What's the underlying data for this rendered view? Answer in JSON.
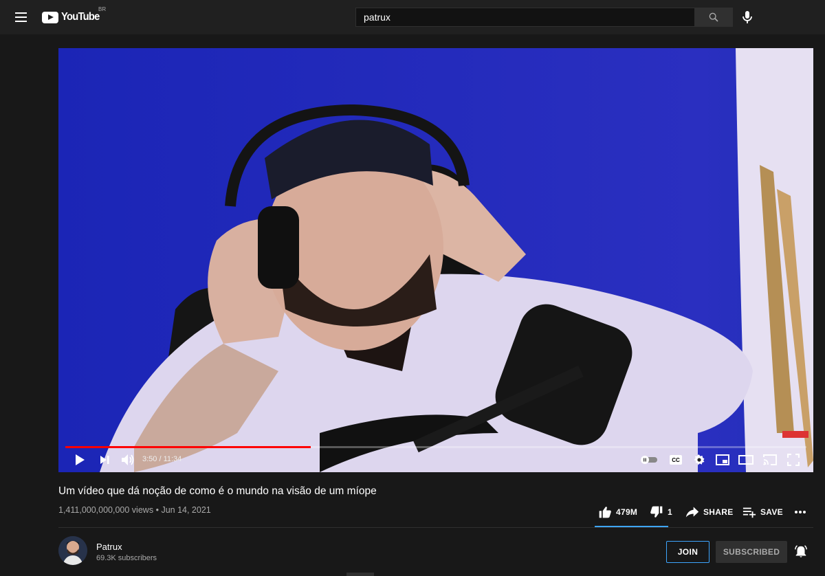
{
  "masthead": {
    "logo_text": "YouTube",
    "country_code": "BR",
    "search_value": "patrux",
    "icons": {
      "menu": "hamburger-icon",
      "search": "search-icon",
      "mic": "microphone-icon"
    }
  },
  "player": {
    "time_display": "3:50 / 11:34",
    "progress_fraction": 0.331,
    "controls": [
      "play-icon",
      "next-icon",
      "volume-icon",
      "autoplay-toggle",
      "captions-icon",
      "settings-icon",
      "miniplayer-icon",
      "theater-icon",
      "cast-icon",
      "fullscreen-icon"
    ],
    "captions_label": "CC"
  },
  "video": {
    "title": "Um vídeo que dá noção de como é o mundo na visão de um míope",
    "views": "1,411,000,000,000 views",
    "separator": "•",
    "date": "Jun 14, 2021"
  },
  "actions": {
    "like_count": "479M",
    "dislike_count": "1",
    "share_label": "SHARE",
    "save_label": "SAVE",
    "like_ratio": 1.0
  },
  "channel": {
    "name": "Patrux",
    "subscribers": "69.3K subscribers",
    "join_label": "JOIN",
    "subscribed_label": "SUBSCRIBED"
  },
  "colors": {
    "background": "#181818",
    "masthead": "#202020",
    "accent_red": "#ff0000",
    "accent_blue": "#3ea6ff",
    "muted_text": "#aaaaaa"
  }
}
